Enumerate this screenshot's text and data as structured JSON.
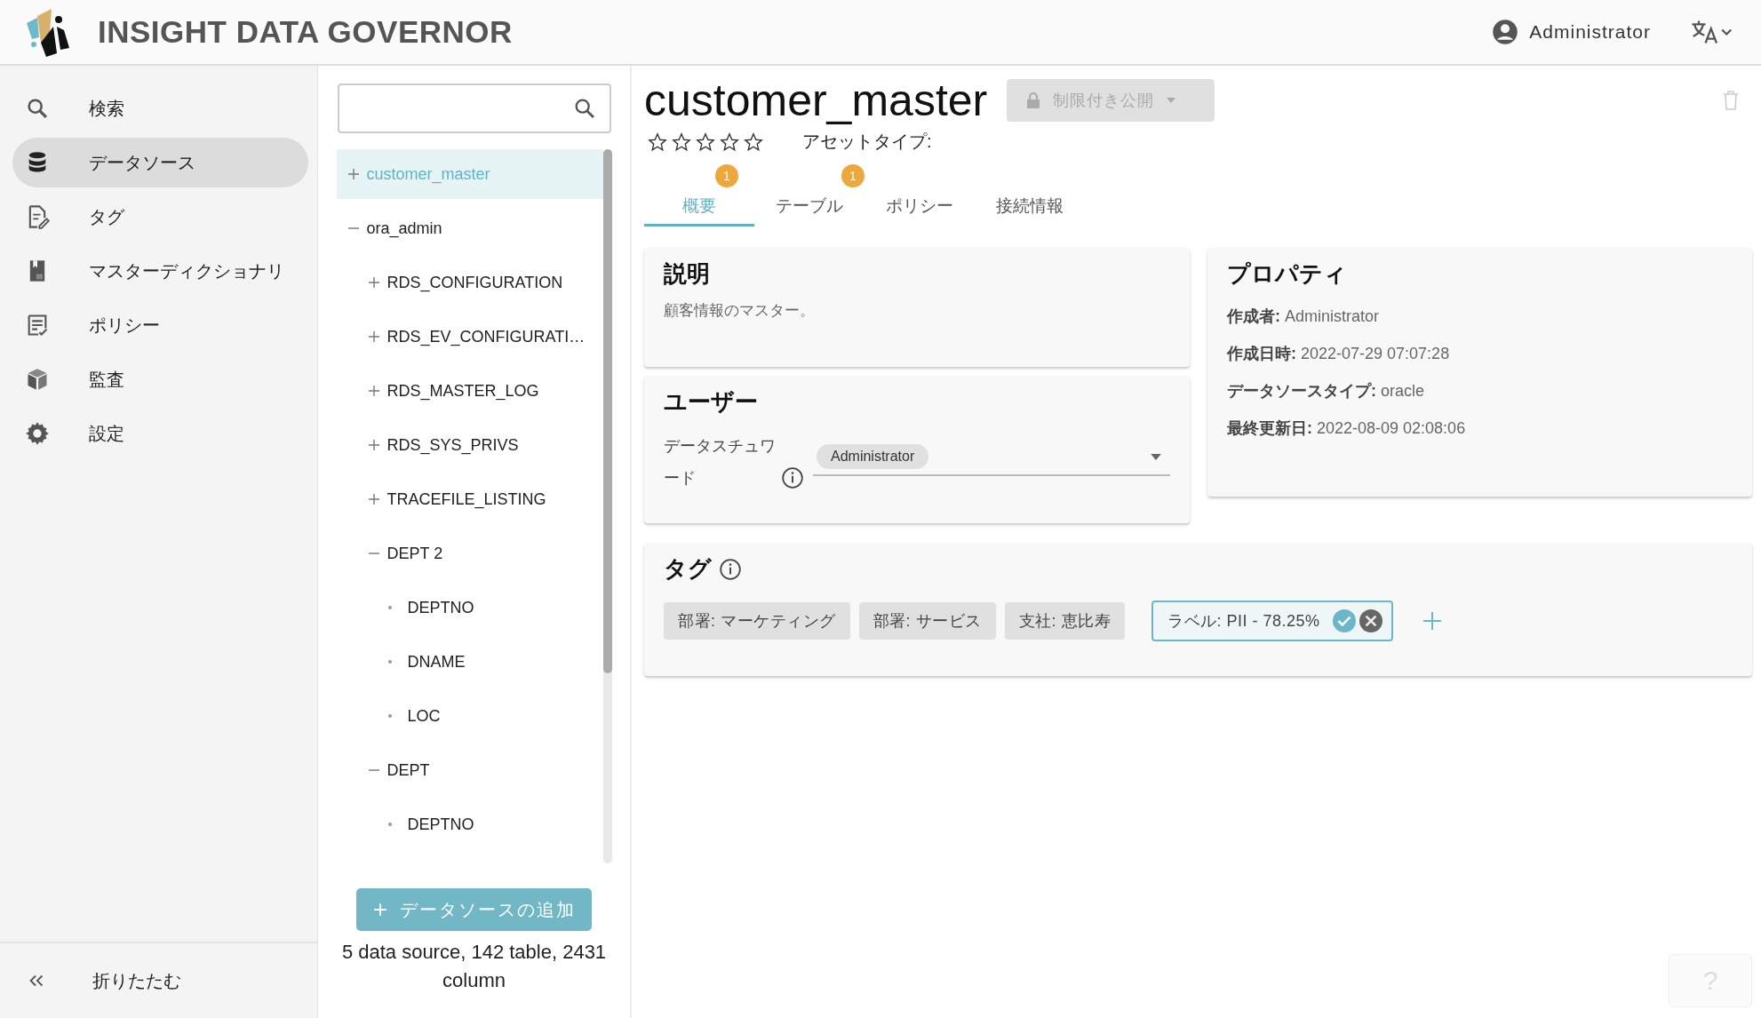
{
  "header": {
    "title": "INSIGHT DATA GOVERNOR",
    "user": "Administrator"
  },
  "sidebar": {
    "items": [
      {
        "label": "検索",
        "selected": false
      },
      {
        "label": "データソース",
        "selected": true
      },
      {
        "label": "タグ",
        "selected": false
      },
      {
        "label": "マスターディクショナリ",
        "selected": false
      },
      {
        "label": "ポリシー",
        "selected": false
      },
      {
        "label": "監査",
        "selected": false
      },
      {
        "label": "設定",
        "selected": false
      }
    ],
    "collapse": {
      "label": "折りたたむ"
    }
  },
  "tree": {
    "items": [
      {
        "label": "customer_master",
        "kind": "node",
        "expanded": false,
        "selected": true
      },
      {
        "label": "ora_admin",
        "kind": "node",
        "expanded": true,
        "selected": false,
        "children": [
          {
            "label": "RDS_CONFIGURATION",
            "kind": "node",
            "expanded": false,
            "selected": false
          },
          {
            "label": "RDS_EV_CONFIGURATI…",
            "kind": "node",
            "expanded": false,
            "selected": false
          },
          {
            "label": "RDS_MASTER_LOG",
            "kind": "node",
            "expanded": false,
            "selected": false
          },
          {
            "label": "RDS_SYS_PRIVS",
            "kind": "node",
            "expanded": false,
            "selected": false
          },
          {
            "label": "TRACEFILE_LISTING",
            "kind": "node",
            "expanded": false,
            "selected": false
          },
          {
            "label": "DEPT 2",
            "kind": "node",
            "expanded": true,
            "selected": false,
            "children": [
              {
                "label": "DEPTNO",
                "kind": "leaf",
                "selected": false
              },
              {
                "label": "DNAME",
                "kind": "leaf",
                "selected": false
              },
              {
                "label": "LOC",
                "kind": "leaf",
                "selected": false
              }
            ]
          },
          {
            "label": "DEPT",
            "kind": "node",
            "expanded": true,
            "selected": false,
            "children": [
              {
                "label": "DEPTNO",
                "kind": "leaf",
                "selected": false
              }
            ]
          }
        ]
      }
    ],
    "add_button": "データソースの追加",
    "stats": "5 data source, 142 table, 2431 column"
  },
  "asset": {
    "title": "customer_master",
    "visibility": "制限付き公開",
    "stars": 0,
    "asset_type_label": "アセットタイプ:"
  },
  "tabs": [
    {
      "label": "概要",
      "badge": "1",
      "selected": true
    },
    {
      "label": "テーブル",
      "badge": "1",
      "selected": false
    },
    {
      "label": "ポリシー",
      "selected": false
    },
    {
      "label": "接続情報",
      "selected": false
    }
  ],
  "description": {
    "heading": "説明",
    "text": "顧客情報のマスター。"
  },
  "users": {
    "heading": "ユーザー",
    "steward_label": "データスチュワード",
    "steward": "Administrator"
  },
  "properties": {
    "heading": "プロパティ",
    "items": [
      "**作成者:** Administrator",
      "**作成日時:** 2022-07-29 07:07:28",
      "**データソースタイプ:** oracle",
      "**最終更新日:** 2022-08-09 02:08:06"
    ]
  },
  "tags": {
    "heading": "タグ",
    "items": [
      {
        "label": "部署: マーケティング",
        "kind": "tag"
      },
      {
        "label": "部署: サービス",
        "kind": "tag"
      },
      {
        "label": "支社: 恵比寿",
        "kind": "tag"
      },
      {
        "label": "ラベル: PII - 78.25%",
        "kind": "suggested"
      }
    ]
  },
  "help": "?"
}
